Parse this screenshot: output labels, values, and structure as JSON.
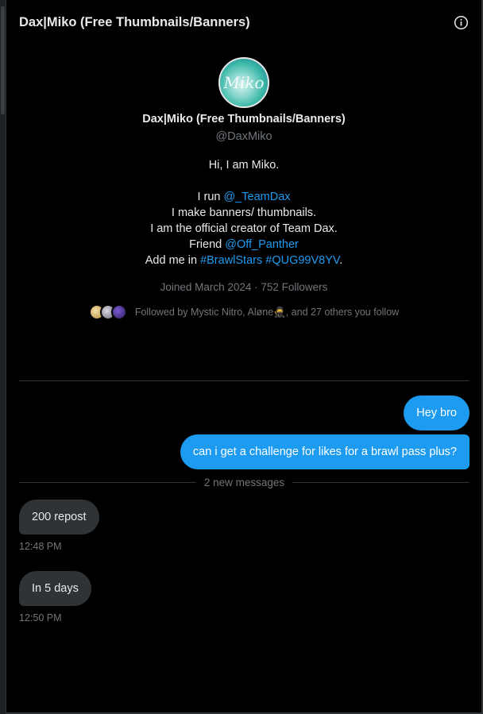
{
  "header": {
    "title": "Dax|Miko (Free Thumbnails/Banners)",
    "info_icon": "info-icon"
  },
  "profile": {
    "avatar_text": "Miko",
    "display_name": "Dax|Miko (Free Thumbnails/Banners)",
    "handle": "@DaxMiko",
    "bio": {
      "line1": "Hi, I am Miko.",
      "line2_prefix": "I run ",
      "line2_link": "@_TeamDax",
      "line3": "I make banners/ thumbnails.",
      "line4": "I am the official creator of Team Dax.",
      "line5_prefix": "Friend ",
      "line5_link": "@Off_Panther",
      "line6_prefix": "Add me in ",
      "line6_link1": "#BrawlStars",
      "line6_space": " ",
      "line6_link2": "#QUG99V8YV",
      "line6_suffix": "."
    },
    "joined": "Joined March 2024 · 752 Followers",
    "followed_by": "Followed by Mystic Nitro, Aløne🥷, and 27 others you follow"
  },
  "messages": {
    "outgoing": [
      {
        "text": "Hey bro"
      },
      {
        "text": "can i get a challenge for likes for a brawl pass plus?"
      }
    ],
    "new_messages_label": "2 new messages",
    "incoming": [
      {
        "text": "200 repost",
        "time": "12:48 PM"
      },
      {
        "text": "In 5 days",
        "time": "12:50 PM"
      }
    ]
  },
  "colors": {
    "accent": "#1d9bf0",
    "background": "#000000",
    "bubble_in": "#2f3336",
    "muted_text": "#71767b"
  }
}
